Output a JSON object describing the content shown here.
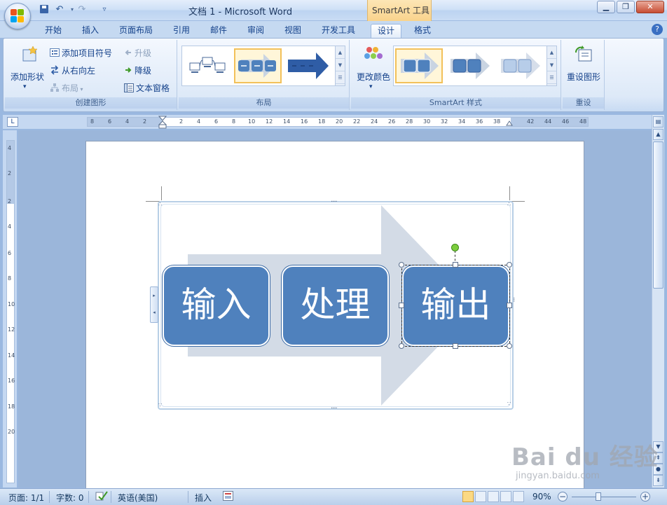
{
  "window": {
    "title": "文档 1 - Microsoft Word",
    "context_tab": "SmartArt 工具",
    "buttons": [
      "minimize",
      "restore",
      "close"
    ]
  },
  "quick_access": [
    "save-icon",
    "undo-icon",
    "redo-icon",
    "customize-icon"
  ],
  "tabs": [
    {
      "label": "开始"
    },
    {
      "label": "插入"
    },
    {
      "label": "页面布局"
    },
    {
      "label": "引用"
    },
    {
      "label": "邮件"
    },
    {
      "label": "审阅"
    },
    {
      "label": "视图"
    },
    {
      "label": "开发工具"
    },
    {
      "label": "设计"
    },
    {
      "label": "格式"
    }
  ],
  "active_tab": "设计",
  "ribbon": {
    "create_graphic": {
      "label": "创建图形",
      "add_shape": "添加形状",
      "add_bullet": "添加项目符号",
      "right_to_left": "从右向左",
      "layout": "布局",
      "promote": "升级",
      "demote": "降级",
      "text_pane": "文本窗格"
    },
    "layouts": {
      "label": "布局"
    },
    "styles": {
      "label": "SmartArt 样式",
      "change_colors": "更改颜色"
    },
    "reset": {
      "label": "重设",
      "reset_graphic": "重设图形"
    }
  },
  "ruler": {
    "h_ticks": [
      "8",
      "6",
      "4",
      "2",
      "2",
      "4",
      "6",
      "8",
      "10",
      "12",
      "14",
      "16",
      "18",
      "20",
      "22",
      "24",
      "26",
      "28",
      "30",
      "32",
      "34",
      "36",
      "38",
      "42",
      "44",
      "46",
      "48"
    ],
    "v_ticks": [
      "4",
      "2",
      "2",
      "4",
      "6",
      "8",
      "10",
      "12",
      "14",
      "16",
      "18",
      "20"
    ]
  },
  "smartart": {
    "boxes": [
      "输入",
      "处理",
      "输出"
    ],
    "colors": {
      "box_fill": "#4f81bd",
      "arrow_fill": "#d3dbe6"
    }
  },
  "statusbar": {
    "page": "页面: 1/1",
    "words": "字数: 0",
    "language": "英语(美国)",
    "mode": "插入",
    "zoom": "90%"
  },
  "watermark": {
    "main": "Bai du 经验",
    "sub": "jingyan.baidu.com"
  }
}
